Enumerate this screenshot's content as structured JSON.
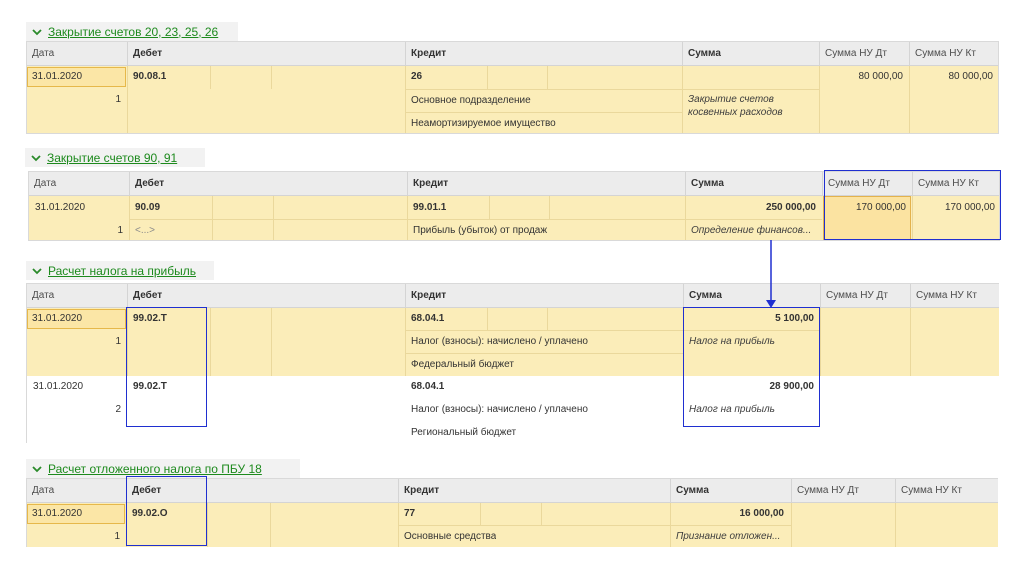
{
  "columns": {
    "date": "Дата",
    "debit": "Дебет",
    "credit": "Кредит",
    "sum": "Сумма",
    "sum_nu_dt": "Сумма НУ Дт",
    "sum_nu_kt": "Сумма НУ Кт"
  },
  "sections": [
    {
      "title": "Закрытие счетов 20, 23, 25, 26",
      "rows": [
        {
          "date": "31.01.2020",
          "num": "1",
          "debit": "90.08.1",
          "credit": "26",
          "credit_sub1": "Основное подразделение",
          "credit_sub2": "Неамортизируемое имущество",
          "sum": "",
          "content": "Закрытие счетов косвенных расходов",
          "content_line1": "Закрытие счетов",
          "content_line2": "косвенных расходов",
          "nu_dt": "80 000,00",
          "nu_kt": "80 000,00"
        }
      ]
    },
    {
      "title": "Закрытие счетов 90, 91",
      "rows": [
        {
          "date": "31.01.2020",
          "num": "1",
          "debit": "90.09",
          "debit_sub1": "<...>",
          "credit": "99.01.1",
          "credit_sub1": "Прибыль (убыток) от продаж",
          "sum": "250 000,00",
          "content": "Определение финансов...",
          "nu_dt": "170 000,00",
          "nu_kt": "170 000,00"
        }
      ]
    },
    {
      "title": "Расчет налога на прибыль",
      "rows": [
        {
          "date": "31.01.2020",
          "num": "1",
          "debit": "99.02.Т",
          "credit": "68.04.1",
          "credit_sub1": "Налог (взносы): начислено / уплачено",
          "credit_sub2": "Федеральный бюджет",
          "sum": "5 100,00",
          "content": "Налог на прибыль",
          "nu_dt": "",
          "nu_kt": ""
        },
        {
          "date": "31.01.2020",
          "num": "2",
          "debit": "99.02.Т",
          "credit": "68.04.1",
          "credit_sub1": "Налог (взносы): начислено / уплачено",
          "credit_sub2": "Региональный бюджет",
          "sum": "28 900,00",
          "content": "Налог на прибыль",
          "nu_dt": "",
          "nu_kt": ""
        }
      ]
    },
    {
      "title": "Расчет отложенного налога по ПБУ 18",
      "rows": [
        {
          "date": "31.01.2020",
          "num": "1",
          "debit": "99.02.О",
          "credit": "77",
          "credit_sub1": "Основные средства",
          "sum": "16 000,00",
          "content": "Признание отложен...",
          "nu_dt": "",
          "nu_kt": ""
        }
      ]
    }
  ],
  "icons": {
    "collapse": "chevron-down-icon",
    "arrow": "arrow-down-icon"
  },
  "colors": {
    "row_bg": "#fbedb9",
    "header_bg": "#ececec",
    "section_title": "#1d8a1d",
    "highlight_border": "#1f2fd0",
    "selected_cell": "#fbe3a1"
  }
}
